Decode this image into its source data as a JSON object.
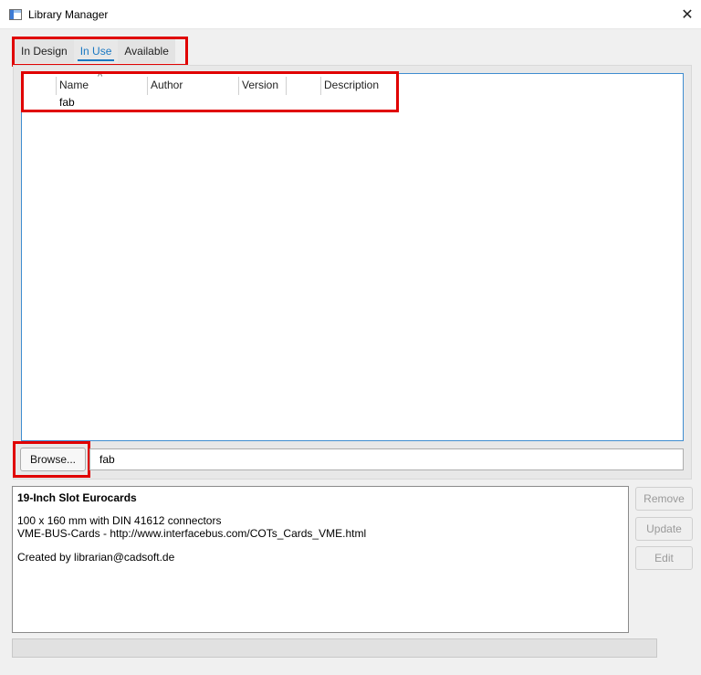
{
  "window": {
    "title": "Library Manager"
  },
  "tabs": [
    {
      "label": "In Design",
      "active": false
    },
    {
      "label": "In Use",
      "active": true
    },
    {
      "label": "Available",
      "active": false
    }
  ],
  "table": {
    "columns": [
      "Name",
      "Author",
      "Version",
      "Description"
    ],
    "rows": [
      {
        "name": "fab",
        "author": "",
        "version": "",
        "description": ""
      }
    ],
    "sorted_column": "Name"
  },
  "browse_button": {
    "label": "Browse..."
  },
  "path_field": {
    "value": "fab"
  },
  "description": {
    "title": "19-Inch Slot Eurocards",
    "line1": "100 x 160 mm with DIN 41612 connectors",
    "line2": "VME-BUS-Cards - http://www.interfacebus.com/COTs_Cards_VME.html",
    "line3": "Created by librarian@cadsoft.de"
  },
  "side_buttons": {
    "remove": "Remove",
    "update": "Update",
    "edit": "Edit"
  },
  "progress": {
    "value": 0
  },
  "colors": {
    "accent": "#1a78c2",
    "highlight": "#e00000"
  }
}
